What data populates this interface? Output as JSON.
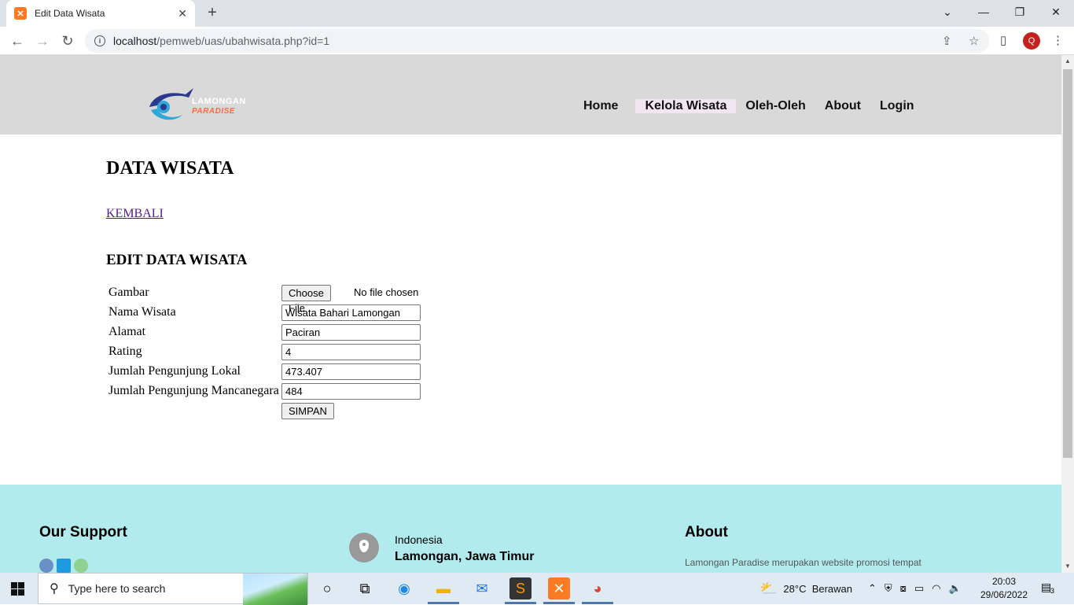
{
  "browser": {
    "tab_title": "Edit Data Wisata",
    "url_host": "localhost",
    "url_path": "/pemweb/uas/ubahwisata.php?id=1",
    "profile_initial": "Q"
  },
  "header": {
    "logo_line1": "LAMONGAN",
    "logo_line2": "PARADISE",
    "nav": [
      "Home",
      "Kelola Wisata",
      "Oleh-Oleh",
      "About",
      "Login"
    ],
    "active_nav": "Kelola Wisata"
  },
  "content": {
    "page_title": "DATA WISATA",
    "back_link": "KEMBALI",
    "form_title": "EDIT DATA WISATA",
    "form": {
      "gambar_label": "Gambar",
      "file_button": "Choose File",
      "file_status": "No file chosen",
      "nama_label": "Nama Wisata",
      "nama_value": "Wisata Bahari Lamongan",
      "alamat_label": "Alamat",
      "alamat_value": "Paciran",
      "rating_label": "Rating",
      "rating_value": "4",
      "lokal_label": "Jumlah Pengunjung Lokal",
      "lokal_value": "473.407",
      "manca_label": "Jumlah Pengunjung Mancanegara",
      "manca_value": "484",
      "submit_label": "SIMPAN"
    }
  },
  "footer": {
    "support_title": "Our Support",
    "country": "Indonesia",
    "city": "Lamongan, Jawa Timur",
    "about_title": "About",
    "about_text": "Lamongan Paradise merupakan website promosi tempat"
  },
  "taskbar": {
    "search_placeholder": "Type here to search",
    "weather": "28°C  Berawan",
    "time": "20:03",
    "date": "29/06/2022",
    "notification_count": "3"
  },
  "colors": {
    "header_bg": "#d9d9d9",
    "footer_bg": "#b2ebed",
    "active_nav_bg": "#f3e6f3",
    "link_visited": "#551a8b"
  }
}
